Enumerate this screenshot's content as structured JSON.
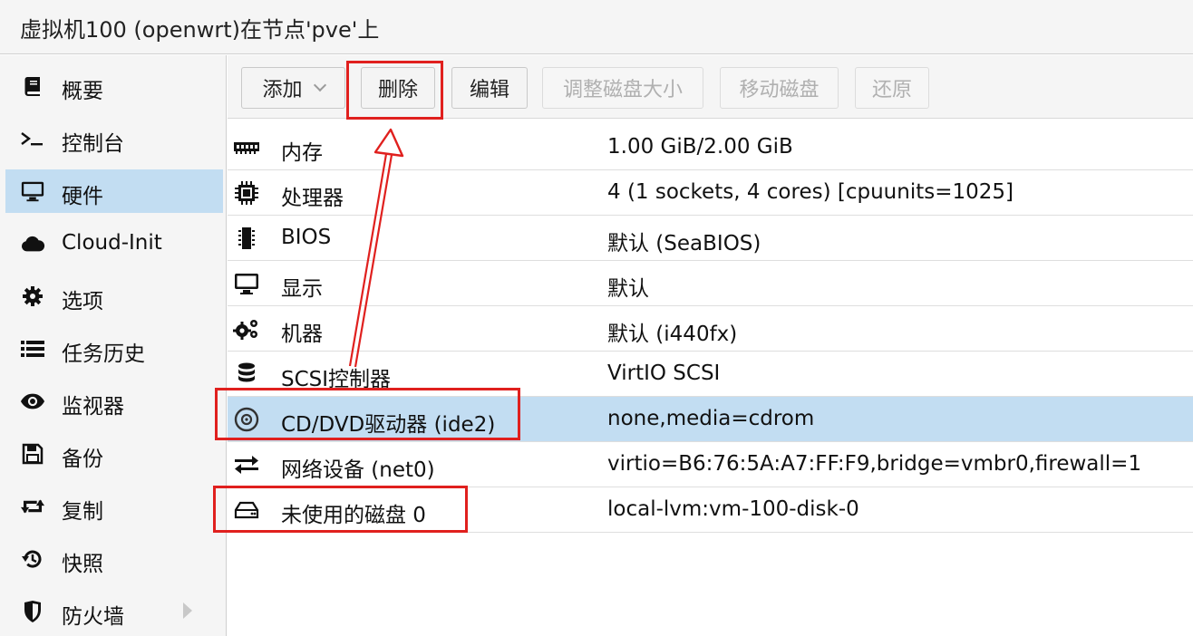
{
  "window": {
    "title": "虚拟机100 (openwrt)在节点'pve'上"
  },
  "sidebar": {
    "items": [
      {
        "label": "概要",
        "icon": "book-icon"
      },
      {
        "label": "控制台",
        "icon": "terminal-icon"
      },
      {
        "label": "硬件",
        "icon": "monitor-icon",
        "selected": true
      },
      {
        "label": "Cloud-Init",
        "icon": "cloud-icon"
      },
      {
        "label": "选项",
        "icon": "gear-icon"
      },
      {
        "label": "任务历史",
        "icon": "list-icon"
      },
      {
        "label": "监视器",
        "icon": "eye-icon"
      },
      {
        "label": "备份",
        "icon": "floppy-icon"
      },
      {
        "label": "复制",
        "icon": "retweet-icon"
      },
      {
        "label": "快照",
        "icon": "history-icon"
      },
      {
        "label": "防火墙",
        "icon": "shield-icon",
        "has_submenu": true
      }
    ]
  },
  "toolbar": {
    "add_label": "添加",
    "remove_label": "删除",
    "edit_label": "编辑",
    "resize_label": "调整磁盘大小",
    "move_label": "移动磁盘",
    "revert_label": "还原"
  },
  "hardware": {
    "rows": [
      {
        "key": "内存",
        "value": "1.00 GiB/2.00 GiB",
        "icon": "memory-icon"
      },
      {
        "key": "处理器",
        "value": "4 (1 sockets, 4 cores) [cpuunits=1025]",
        "icon": "cpu-icon"
      },
      {
        "key": "BIOS",
        "value": "默认 (SeaBIOS)",
        "icon": "microchip-icon"
      },
      {
        "key": "显示",
        "value": "默认",
        "icon": "desktop-icon"
      },
      {
        "key": "机器",
        "value": "默认 (i440fx)",
        "icon": "cogs-icon"
      },
      {
        "key": "SCSI控制器",
        "value": "VirtIO SCSI",
        "icon": "database-icon"
      },
      {
        "key": "CD/DVD驱动器 (ide2)",
        "value": "none,media=cdrom",
        "icon": "cdrom-icon",
        "selected": true
      },
      {
        "key": "网络设备 (net0)",
        "value": "virtio=B6:76:5A:A7:FF:F9,bridge=vmbr0,firewall=1",
        "icon": "exchange-icon"
      },
      {
        "key": "未使用的磁盘 0",
        "value": "local-lvm:vm-100-disk-0",
        "icon": "hdd-icon"
      }
    ]
  },
  "colors": {
    "selection": "#c2ddf2",
    "annotation": "#e0201e"
  }
}
